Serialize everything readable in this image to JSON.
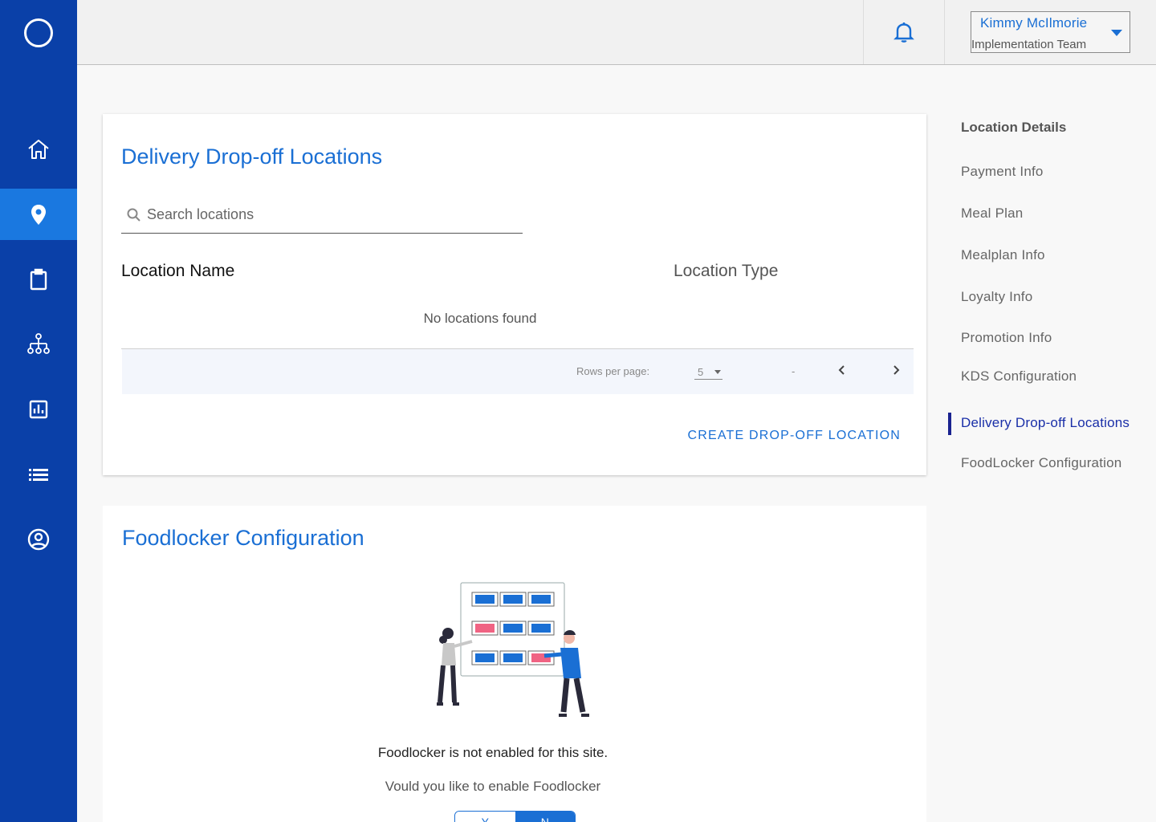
{
  "colors": {
    "sidebar": "#0a40a8",
    "sidebar_active": "#1a78e0",
    "accent": "#1a6fd4",
    "nav_active": "#1a2390"
  },
  "sidebar": {
    "items": [
      {
        "icon": "home-icon"
      },
      {
        "icon": "location-pin-icon",
        "active": true
      },
      {
        "icon": "clipboard-icon"
      },
      {
        "icon": "org-chart-icon"
      },
      {
        "icon": "bar-chart-icon"
      },
      {
        "icon": "list-icon"
      },
      {
        "icon": "user-circle-icon"
      }
    ]
  },
  "header": {
    "user_name": "Kimmy McIlmorie",
    "user_team": "Implementation Team"
  },
  "drop_off": {
    "title": "Delivery Drop-off Locations",
    "search_placeholder": "Search locations",
    "col_name": "Location Name",
    "col_type": "Location Type",
    "empty": "No locations found",
    "rows_per_page_label": "Rows per page:",
    "rows_per_page_value": "5",
    "range": "-",
    "create_label": "CREATE DROP-OFF LOCATION"
  },
  "foodlocker": {
    "title": "Foodlocker Configuration",
    "message": "Foodlocker is not enabled for this site.",
    "question": "Vould you like to enable Foodlocker",
    "yes": "Y",
    "no": "N"
  },
  "right_nav": {
    "heading": "Location Details",
    "items": [
      {
        "label": "Payment Info"
      },
      {
        "label": "Meal Plan"
      },
      {
        "label": "Mealplan Info"
      },
      {
        "label": "Loyalty Info"
      },
      {
        "label": "Promotion Info"
      },
      {
        "label": "KDS Configuration"
      },
      {
        "label": "Delivery Drop-off Locations",
        "active": true
      },
      {
        "label": "FoodLocker Configuration"
      }
    ]
  }
}
